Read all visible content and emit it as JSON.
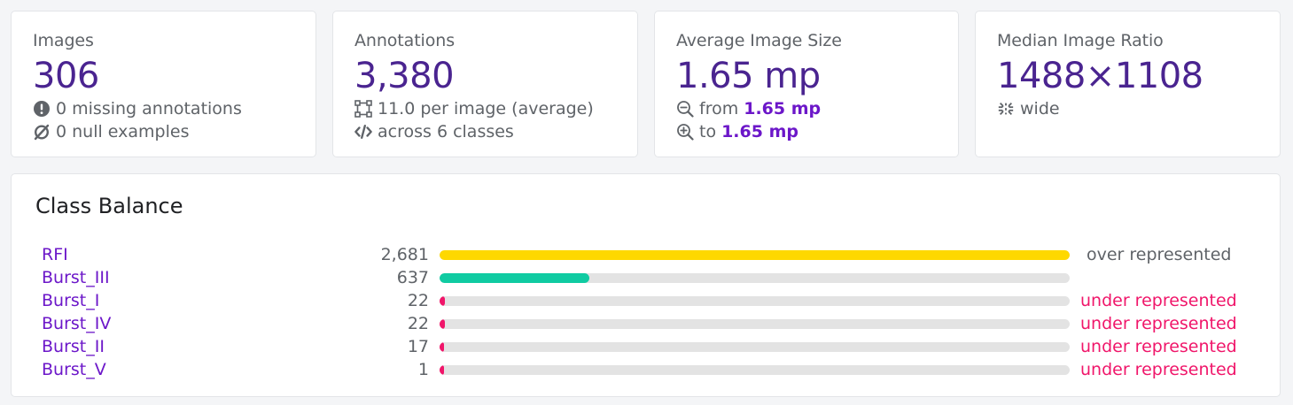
{
  "stats": {
    "images": {
      "label": "Images",
      "value": "306",
      "line1": "0 missing annotations",
      "line2": "0 null examples"
    },
    "annotations": {
      "label": "Annotations",
      "value": "3,380",
      "line1": "11.0 per image (average)",
      "line2": "across 6 classes"
    },
    "avg_size": {
      "label": "Average Image Size",
      "value": "1.65 mp",
      "from_label": "from",
      "from_value": "1.65 mp",
      "to_label": "to",
      "to_value": "1.65 mp"
    },
    "median_ratio": {
      "label": "Median Image Ratio",
      "value": "1488×1108",
      "line1": "wide"
    }
  },
  "class_balance": {
    "title": "Class Balance",
    "max_count": 2681,
    "classes": [
      {
        "name": "RFI",
        "count": "2,681",
        "value": 2681,
        "status": "over represented",
        "status_type": "over",
        "color": "#fed800"
      },
      {
        "name": "Burst_III",
        "count": "637",
        "value": 637,
        "status": "",
        "status_type": "normal",
        "color": "#10cba2"
      },
      {
        "name": "Burst_I",
        "count": "22",
        "value": 22,
        "status": "under represented",
        "status_type": "under",
        "color": "#f0166a"
      },
      {
        "name": "Burst_IV",
        "count": "22",
        "value": 22,
        "status": "under represented",
        "status_type": "under",
        "color": "#f0166a"
      },
      {
        "name": "Burst_II",
        "count": "17",
        "value": 17,
        "status": "under represented",
        "status_type": "under",
        "color": "#f0166a"
      },
      {
        "name": "Burst_V",
        "count": "1",
        "value": 1,
        "status": "under represented",
        "status_type": "under",
        "color": "#f0166a"
      }
    ]
  },
  "icons": {
    "missing": "exclamation-circle-icon",
    "null": "null-set-icon",
    "bbox": "bounding-box-icon",
    "classes": "code-icon",
    "zoom_out": "zoom-out-icon",
    "zoom_in": "zoom-in-icon",
    "ratio": "compress-horizontal-icon"
  },
  "colors": {
    "accent_value": "#4a2490",
    "accent_bold": "#6c17c9",
    "over": "#5f6368",
    "under": "#f0166a"
  }
}
